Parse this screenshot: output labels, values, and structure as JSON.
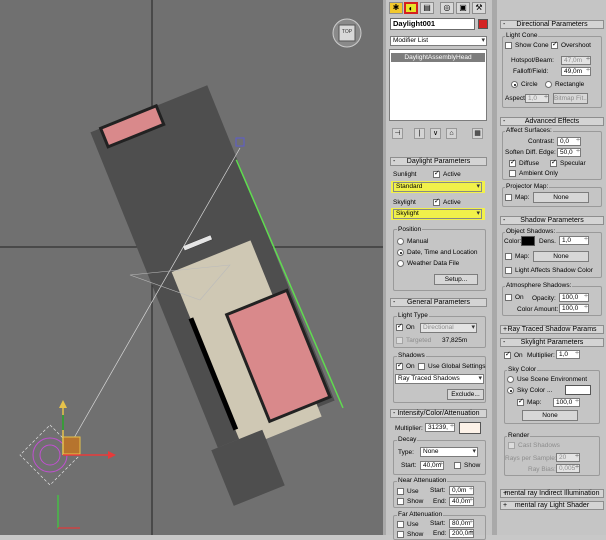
{
  "object_name": "Daylight001",
  "modifier_list": "Modifier List",
  "stack_item": "DaylightAssemblyHead",
  "tabs": {
    "create": "✱",
    "modify": "◐",
    "hierarchy": "▤",
    "motion": "◎",
    "display": "▣",
    "utilities": "⚒"
  },
  "daylight": {
    "title": "Daylight Parameters",
    "sunlight_label": "Sunlight",
    "sun_active": "Active",
    "sun_type": "Standard",
    "skylight_label": "Skylight",
    "sky_active": "Active",
    "sky_type": "Skylight",
    "position_title": "Position",
    "pos_manual": "Manual",
    "pos_date": "Date, Time and Location",
    "pos_weather": "Weather Data File",
    "setup": "Setup..."
  },
  "general": {
    "title": "General Parameters",
    "light_type_title": "Light Type",
    "on": "On",
    "type": "Directional",
    "targeted": "Targeted",
    "target_dist": "37,825m",
    "shadows_title": "Shadows",
    "sh_on": "On",
    "use_global": "Use Global Settings",
    "shadow_type": "Ray Traced Shadows",
    "exclude": "Exclude..."
  },
  "intensity": {
    "title": "Intensity/Color/Attenuation",
    "multiplier_label": "Multiplier:",
    "multiplier": "31239,",
    "decay_title": "Decay",
    "type_label": "Type:",
    "decay_type": "None",
    "start_label": "Start:",
    "decay_start": "40,0m",
    "show": "Show",
    "near_title": "Near Attenuation",
    "near_use": "Use",
    "near_show": "Show",
    "near_start_label": "Start:",
    "near_start": "0,0m",
    "near_end_label": "End:",
    "near_end": "40,0m",
    "far_title": "Far Attenuation",
    "far_use": "Use",
    "far_show": "Show",
    "far_start_label": "Start:",
    "far_start": "80,0m",
    "far_end_label": "End:",
    "far_end": "200,0m"
  },
  "directional": {
    "title": "Directional Parameters",
    "light_cone_title": "Light Cone",
    "show_cone": "Show Cone",
    "overshoot": "Overshoot",
    "hotspot_label": "Hotspot/Beam:",
    "hotspot": "47,0m",
    "falloff_label": "Falloff/Field:",
    "falloff": "49,0m",
    "circle": "Circle",
    "rectangle": "Rectangle",
    "aspect_label": "Aspect:",
    "aspect": "1,0",
    "bitmap_fit": "Bitmap Fit..."
  },
  "advanced": {
    "title": "Advanced Effects",
    "affect_title": "Affect Surfaces:",
    "contrast_label": "Contrast:",
    "contrast": "0,0",
    "soften_label": "Soften Diff. Edge:",
    "soften": "50,0",
    "diffuse": "Diffuse",
    "specular": "Specular",
    "ambient_only": "Ambient Only",
    "projector_title": "Projector Map:",
    "map": "Map:",
    "map_btn": "None"
  },
  "shadow": {
    "title": "Shadow Parameters",
    "object_title": "Object Shadows:",
    "color_label": "Color:",
    "dens_label": "Dens.",
    "dens": "1,0",
    "map": "Map:",
    "map_btn": "None",
    "light_affects": "Light Affects Shadow Color",
    "atmo_title": "Atmosphere Shadows:",
    "atmo_on": "On",
    "opacity_label": "Opacity:",
    "opacity": "100,0",
    "color_amount_label": "Color Amount:",
    "color_amount": "100,0"
  },
  "ray_traced_title": "Ray Traced Shadow Params",
  "skylight": {
    "title": "Skylight Parameters",
    "on": "On",
    "multiplier_label": "Multiplier:",
    "multiplier": "1,0",
    "sky_color_title": "Sky Color",
    "use_env": "Use Scene Environment",
    "sky_color": "Sky Color ...",
    "map": "Map:",
    "map_val": "100,0",
    "map_btn": "None",
    "render_title": "Render",
    "cast_shadows": "Cast Shadows",
    "rays_label": "Rays per Sample:",
    "rays": "20",
    "ray_bias_label": "Ray Bias:",
    "ray_bias": "0,005"
  },
  "mr_indirect": "mental ray Indirect Illumination",
  "mr_shader": "mental ray Light Shader",
  "viewport": {
    "cube_label": "TOP"
  },
  "colors": {
    "roof": "#d9898b",
    "shadow_black": "#000000",
    "selection": "#ecec3c",
    "gizmo": "#c050d0"
  }
}
